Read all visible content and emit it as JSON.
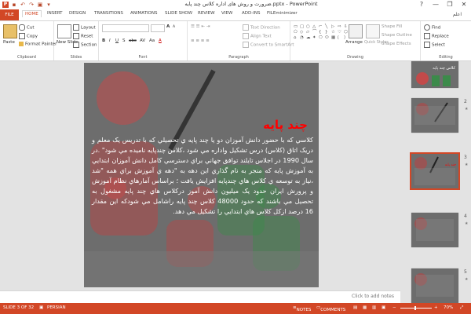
{
  "titlebar": {
    "title": "ضرورت و روش های اداره کلاس چند پایه.pptx - PowerPoint",
    "help": "?",
    "minimize": "—",
    "restore": "❐",
    "close": "✕"
  },
  "tabs": [
    "FILE",
    "HOME",
    "INSERT",
    "DESIGN",
    "TRANSITIONS",
    "ANIMATIONS",
    "SLIDE SHOW",
    "REVIEW",
    "VIEW",
    "ADD-INS",
    "FILEminimizer"
  ],
  "active_tab": "HOME",
  "user": "اعلم",
  "ribbon": {
    "clipboard": {
      "label": "Clipboard",
      "paste": "Paste",
      "cut": "Cut",
      "copy": "Copy",
      "format_painter": "Format Painter"
    },
    "slides": {
      "label": "Slides",
      "new_slide": "New Slide",
      "layout": "Layout",
      "reset": "Reset",
      "section": "Section"
    },
    "font": {
      "label": "Font",
      "bold": "B",
      "italic": "I",
      "underline": "U",
      "shadow": "S",
      "strike": "abc",
      "spacing": "AV",
      "case": "Aa",
      "font_color": "A",
      "grow": "A",
      "shrink": "A"
    },
    "paragraph": {
      "label": "Paragraph",
      "text_direction": "Text Direction",
      "align_text": "Align Text",
      "smartart": "Convert to SmartArt"
    },
    "drawing": {
      "label": "Drawing",
      "arrange": "Arrange",
      "quick_styles": "Quick Styles",
      "shape_fill": "Shape Fill",
      "shape_outline": "Shape Outline",
      "shape_effects": "Shape Effects"
    },
    "editing": {
      "label": "Editing",
      "find": "Find",
      "replace": "Replace",
      "select": "Select"
    }
  },
  "slide": {
    "title": "چند پایه",
    "body": "کلاسي که با حضور دانش آموزان دو يا چند پايه ي تحصيلي که با تدريس يک معلم و دريک اتاق (کلاس) درس تشکيل واداره مي شود ،کلاس چندپايه ناميده مي شود\" .در سال 1990 در اجلاس تايلند توافق جهاني براي دسترسي کامل دانش آموزان ابتدايي به آموزش پايه که منجر به نام گذاري اين دهه به \"دهه ي آموزش براي همه \"شد ،نياز به توسعه ي کلاس هاي چندپايه افزايش يافت ؛ براساس آمارهاي نظام آموزش و پرورش ايران حدود يک ميليون دانش آموز درکلاس هاي چند پايه مشغول به تحصيل مي باشند که حدود 48000 کلاس چند پايه راشامل مي شودکه اين مقدار 16 درصد ازکل کلاس هاي ابتدايي را تشکيل مي دهد."
  },
  "thumbnails": [
    {
      "number": "",
      "star": "",
      "title": "کلاس چند پایه"
    },
    {
      "number": "2",
      "star": "★",
      "title": ""
    },
    {
      "number": "3",
      "star": "★",
      "title": "چند پایه"
    },
    {
      "number": "4",
      "star": "★",
      "title": ""
    },
    {
      "number": "5",
      "star": "★",
      "title": ""
    }
  ],
  "notes_placeholder": "Click to add notes",
  "status": {
    "slide_info": "SLIDE 3 OF 32",
    "language": "PERSIAN",
    "notes": "NOTES",
    "comments": "COMMENTS",
    "zoom_minus": "−",
    "zoom_plus": "+",
    "zoom": "70%"
  },
  "colors": {
    "accent": "#d24726",
    "slide_title": "#ff0000",
    "slide_bg": "#6d6d6d"
  }
}
